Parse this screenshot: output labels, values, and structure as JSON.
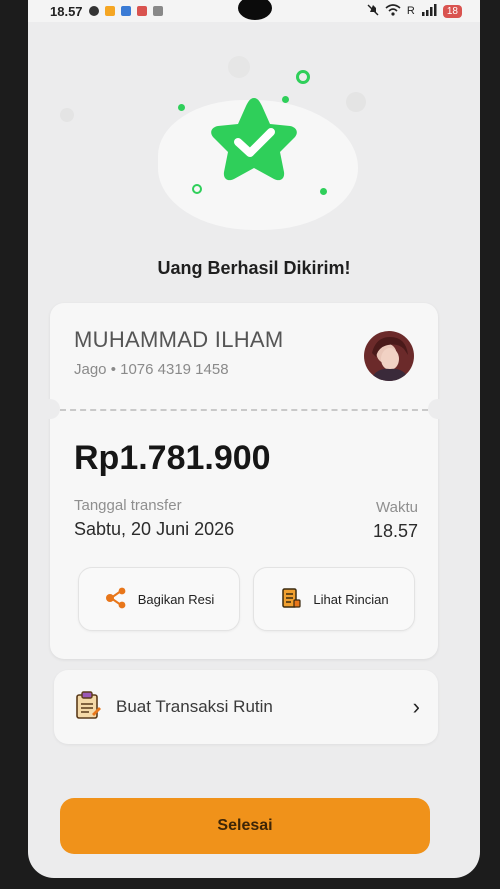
{
  "status_bar": {
    "time": "18.57",
    "network": "R",
    "battery": "18"
  },
  "colors": {
    "success_green": "#2fcf5a",
    "accent_orange": "#f0921a",
    "card_bg": "#f7f7f7"
  },
  "header": {
    "title": "Uang Berhasil Dikirim!",
    "icon": "star-check-icon"
  },
  "recipient": {
    "name": "MUHAMMAD ILHAM",
    "account": "Jago • 1076 4319 1458",
    "avatar": "avatar"
  },
  "transfer": {
    "amount": "Rp1.781.900",
    "date_label": "Tanggal transfer",
    "date_value": "Sabtu, 20 Juni 2026",
    "time_label": "Waktu",
    "time_value": "18.57"
  },
  "actions": {
    "share_label": "Bagikan Resi",
    "share_icon": "share-icon",
    "details_label": "Lihat Rincian",
    "details_icon": "receipt-icon"
  },
  "recurring": {
    "label": "Buat Transaksi Rutin",
    "icon": "clipboard-icon",
    "chevron": "›"
  },
  "footer": {
    "done_label": "Selesai"
  }
}
